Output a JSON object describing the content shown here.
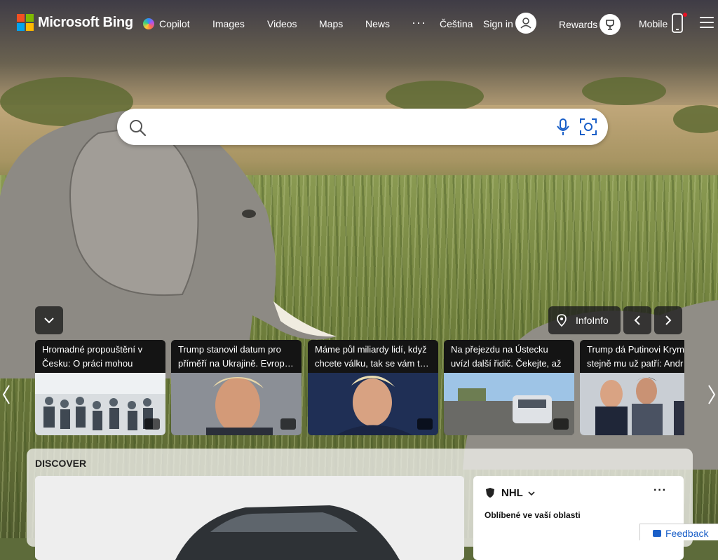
{
  "header": {
    "brand": "Microsoft Bing",
    "nav": [
      "Copilot",
      "Images",
      "Videos",
      "Maps",
      "News"
    ],
    "language": "Čeština",
    "sign_in": "Sign in",
    "rewards": "Rewards",
    "mobile": "Mobile"
  },
  "search": {
    "placeholder": ""
  },
  "carousel": {
    "info_label": "InfoInfo",
    "cards": [
      {
        "title": "Hromadné propouštění v Česku: O práci mohou přijí…"
      },
      {
        "title": "Trump stanovil datum pro příměří na Ukrajině. Evrop…"
      },
      {
        "title": "Máme půl miliardy lidí, když chcete válku, tak se vám t…"
      },
      {
        "title": "Na přejezdu na Ústecku uvízl další řidič. Čekejte, až ta…"
      },
      {
        "title": "Trump dá Putinovi Krym stejně mu už patří: Andr"
      }
    ]
  },
  "discover": {
    "label": "DISCOVER",
    "nhl": {
      "title": "NHL",
      "more": "···",
      "subtitle": "Oblíbené ve vaší oblasti"
    }
  },
  "feedback": "Feedback",
  "colors": {
    "ms_red": "#f25022",
    "ms_green": "#7fba00",
    "ms_blue": "#00a4ef",
    "ms_yellow": "#ffb900",
    "notify": "#e81123"
  }
}
